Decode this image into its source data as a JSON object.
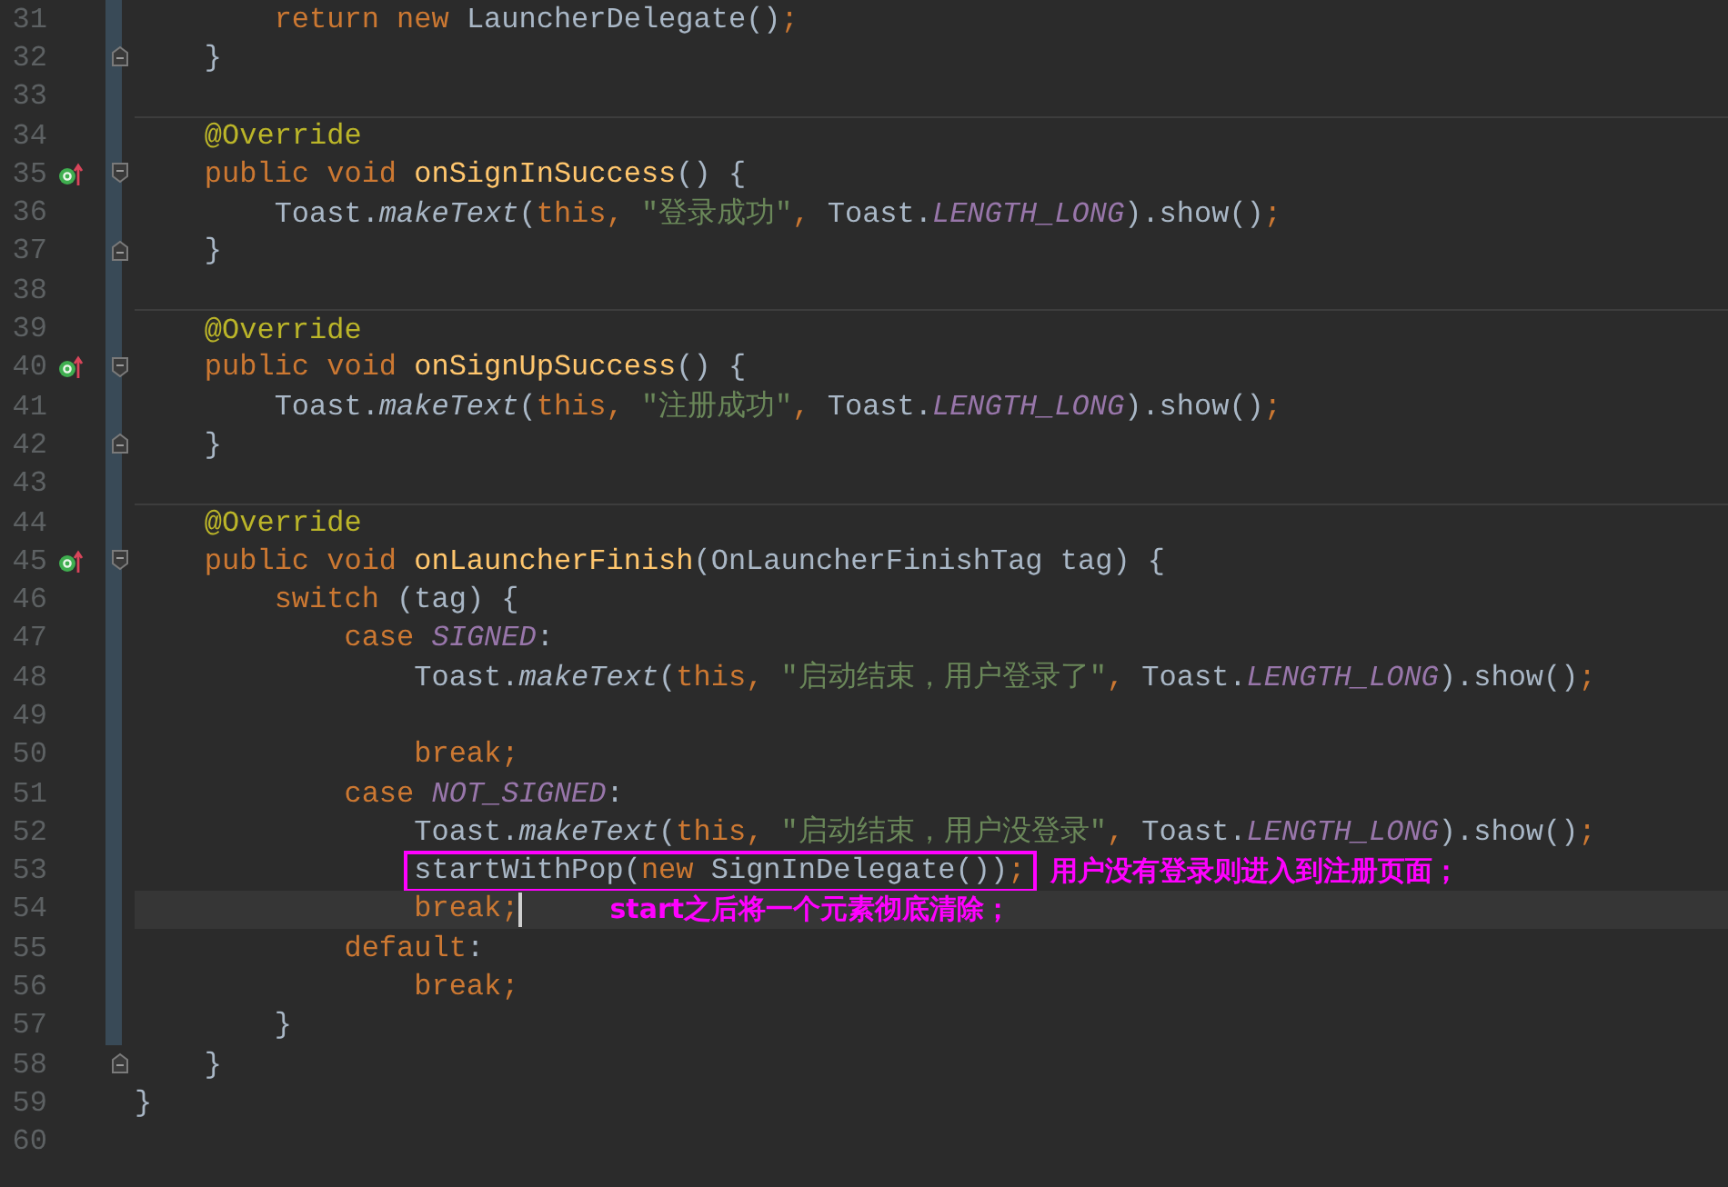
{
  "editor": {
    "lines": [
      {
        "number": "31",
        "kind": "code",
        "current": false,
        "tokens": [
          {
            "kind": "keyword",
            "text": "        return new "
          },
          {
            "kind": "plain",
            "text": "LauncherDelegate()"
          },
          {
            "kind": "keyword",
            "text": ";"
          }
        ]
      },
      {
        "number": "32",
        "kind": "block-end",
        "current": false,
        "tokens": [
          {
            "kind": "plain",
            "text": "    }"
          }
        ]
      },
      {
        "number": "33",
        "kind": "code",
        "current": false
      },
      {
        "number": "34",
        "kind": "annotation",
        "current": false,
        "tokens": [
          {
            "kind": "annotation",
            "text": "    @Override"
          }
        ]
      },
      {
        "number": "35",
        "kind": "method",
        "current": false,
        "tokens": [
          {
            "kind": "keyword",
            "text": "    public void "
          },
          {
            "kind": "declaration",
            "text": "onSignInSuccess"
          },
          {
            "kind": "plain",
            "text": "() {"
          }
        ]
      },
      {
        "number": "36",
        "kind": "code",
        "current": false,
        "tokens": [
          {
            "kind": "plain",
            "text": "        Toast."
          },
          {
            "kind": "static",
            "text": "makeText"
          },
          {
            "kind": "plain",
            "text": "("
          },
          {
            "kind": "keyword",
            "text": "this, "
          },
          {
            "kind": "string",
            "text": "\"登录成功\""
          },
          {
            "kind": "keyword",
            "text": ", "
          },
          {
            "kind": "plain",
            "text": "Toast."
          },
          {
            "kind": "constant",
            "text": "LENGTH_LONG"
          },
          {
            "kind": "plain",
            "text": ").show()"
          },
          {
            "kind": "keyword",
            "text": ";"
          }
        ]
      },
      {
        "number": "37",
        "kind": "block-end",
        "current": false,
        "tokens": [
          {
            "kind": "plain",
            "text": "    }"
          }
        ]
      },
      {
        "number": "38",
        "kind": "code",
        "current": false
      },
      {
        "number": "39",
        "kind": "annotation",
        "current": false,
        "tokens": [
          {
            "kind": "annotation",
            "text": "    @Override"
          }
        ]
      },
      {
        "number": "40",
        "kind": "method",
        "current": false,
        "tokens": [
          {
            "kind": "keyword",
            "text": "    public void "
          },
          {
            "kind": "declaration",
            "text": "onSignUpSuccess"
          },
          {
            "kind": "plain",
            "text": "() {"
          }
        ]
      },
      {
        "number": "41",
        "kind": "code",
        "current": false,
        "tokens": [
          {
            "kind": "plain",
            "text": "        Toast."
          },
          {
            "kind": "static",
            "text": "makeText"
          },
          {
            "kind": "plain",
            "text": "("
          },
          {
            "kind": "keyword",
            "text": "this, "
          },
          {
            "kind": "string",
            "text": "\"注册成功\""
          },
          {
            "kind": "keyword",
            "text": ", "
          },
          {
            "kind": "plain",
            "text": "Toast."
          },
          {
            "kind": "constant",
            "text": "LENGTH_LONG"
          },
          {
            "kind": "plain",
            "text": ").show()"
          },
          {
            "kind": "keyword",
            "text": ";"
          }
        ]
      },
      {
        "number": "42",
        "kind": "block-end",
        "current": false,
        "tokens": [
          {
            "kind": "plain",
            "text": "    }"
          }
        ]
      },
      {
        "number": "43",
        "kind": "code",
        "current": false
      },
      {
        "number": "44",
        "kind": "annotation",
        "current": false,
        "tokens": [
          {
            "kind": "annotation",
            "text": "    @Override"
          }
        ]
      },
      {
        "number": "45",
        "kind": "method",
        "current": false,
        "tokens": [
          {
            "kind": "keyword",
            "text": "    public void "
          },
          {
            "kind": "declaration",
            "text": "onLauncherFinish"
          },
          {
            "kind": "plain",
            "text": "(OnLauncherFinishTag tag) {"
          }
        ]
      },
      {
        "number": "46",
        "kind": "code",
        "current": false,
        "tokens": [
          {
            "kind": "keyword",
            "text": "        switch "
          },
          {
            "kind": "plain",
            "text": "(tag) {"
          }
        ]
      },
      {
        "number": "47",
        "kind": "code",
        "current": false,
        "tokens": [
          {
            "kind": "keyword",
            "text": "            case "
          },
          {
            "kind": "constant",
            "text": "SIGNED"
          },
          {
            "kind": "plain",
            "text": ":"
          }
        ]
      },
      {
        "number": "48",
        "kind": "code",
        "current": false,
        "tokens": [
          {
            "kind": "plain",
            "text": "                Toast."
          },
          {
            "kind": "static",
            "text": "makeText"
          },
          {
            "kind": "plain",
            "text": "("
          },
          {
            "kind": "keyword",
            "text": "this, "
          },
          {
            "kind": "string",
            "text": "\"启动结束，用户登录了\""
          },
          {
            "kind": "keyword",
            "text": ", "
          },
          {
            "kind": "plain",
            "text": "Toast."
          },
          {
            "kind": "constant",
            "text": "LENGTH_LONG"
          },
          {
            "kind": "plain",
            "text": ").show()"
          },
          {
            "kind": "keyword",
            "text": ";"
          }
        ]
      },
      {
        "number": "49",
        "kind": "code",
        "current": false
      },
      {
        "number": "50",
        "kind": "code",
        "current": false,
        "tokens": [
          {
            "kind": "keyword",
            "text": "                break;"
          }
        ]
      },
      {
        "number": "51",
        "kind": "code",
        "current": false,
        "tokens": [
          {
            "kind": "keyword",
            "text": "            case "
          },
          {
            "kind": "constant",
            "text": "NOT_SIGNED"
          },
          {
            "kind": "plain",
            "text": ":"
          }
        ]
      },
      {
        "number": "52",
        "kind": "code",
        "current": false,
        "tokens": [
          {
            "kind": "plain",
            "text": "                Toast."
          },
          {
            "kind": "static",
            "text": "makeText"
          },
          {
            "kind": "plain",
            "text": "("
          },
          {
            "kind": "keyword",
            "text": "this, "
          },
          {
            "kind": "string",
            "text": "\"启动结束，用户没登录\""
          },
          {
            "kind": "keyword",
            "text": ", "
          },
          {
            "kind": "plain",
            "text": "Toast."
          },
          {
            "kind": "constant",
            "text": "LENGTH_LONG"
          },
          {
            "kind": "plain",
            "text": ").show()"
          },
          {
            "kind": "keyword",
            "text": ";"
          }
        ]
      },
      {
        "number": "53",
        "kind": "highlighted",
        "current": false,
        "note": "用户没有登录则进入到注册页面；",
        "tokens": [
          {
            "kind": "plain",
            "text": "startWithPop("
          },
          {
            "kind": "keyword",
            "text": "new "
          },
          {
            "kind": "plain",
            "text": "SignInDelegate())"
          },
          {
            "kind": "keyword",
            "text": ";"
          }
        ]
      },
      {
        "number": "54",
        "kind": "code",
        "current": true,
        "note": "start之后将一个元素彻底清除；",
        "tokens": [
          {
            "kind": "keyword",
            "text": "                break;"
          }
        ]
      },
      {
        "number": "55",
        "kind": "code",
        "current": false,
        "tokens": [
          {
            "kind": "keyword",
            "text": "            default"
          },
          {
            "kind": "plain",
            "text": ":"
          }
        ]
      },
      {
        "number": "56",
        "kind": "code",
        "current": false,
        "tokens": [
          {
            "kind": "keyword",
            "text": "                break;"
          }
        ]
      },
      {
        "number": "57",
        "kind": "code",
        "current": false,
        "tokens": [
          {
            "kind": "plain",
            "text": "        }"
          }
        ]
      },
      {
        "number": "58",
        "kind": "block-end",
        "current": false,
        "tokens": [
          {
            "kind": "plain",
            "text": "    }"
          }
        ]
      },
      {
        "number": "59",
        "kind": "code",
        "current": false,
        "tokens": [
          {
            "kind": "plain",
            "text": "}"
          }
        ]
      },
      {
        "number": "60",
        "kind": "code",
        "current": false
      }
    ]
  }
}
